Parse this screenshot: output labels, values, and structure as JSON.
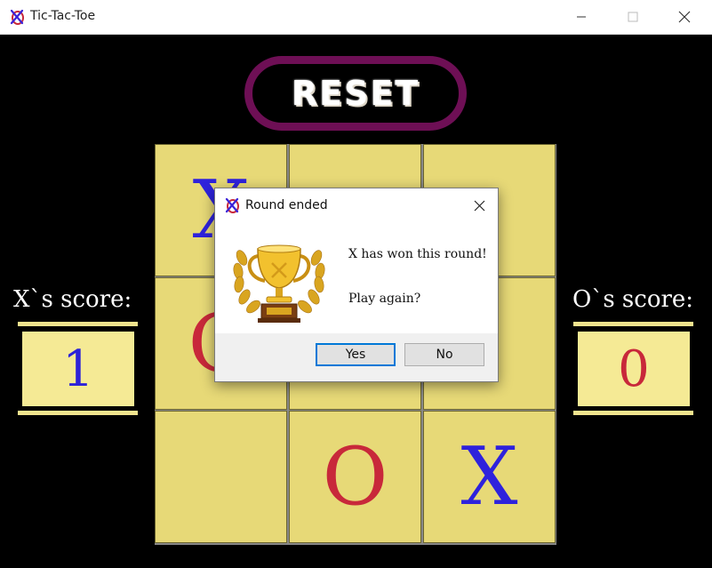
{
  "window": {
    "title": "Tic-Tac-Toe",
    "app_icon": "xo-logo-icon"
  },
  "controls": {
    "reset_label": "RESET"
  },
  "scores": {
    "x_label": "X`s score:",
    "x_value": "1",
    "o_label": "O`s score:",
    "o_value": "0"
  },
  "board": {
    "cells": [
      "X",
      "",
      "",
      "O",
      "",
      "",
      "",
      "O",
      "X"
    ]
  },
  "dialog": {
    "title": "Round ended",
    "message": "X has won this round!",
    "question": "Play again?",
    "yes_label": "Yes",
    "no_label": "No",
    "image": "trophy-icon"
  },
  "colors": {
    "x_mark": "#2e22dc",
    "o_mark": "#c8283a",
    "cell": "#e7d977",
    "reset_border": "#6e0f55",
    "score_box": "#f5ea95"
  }
}
